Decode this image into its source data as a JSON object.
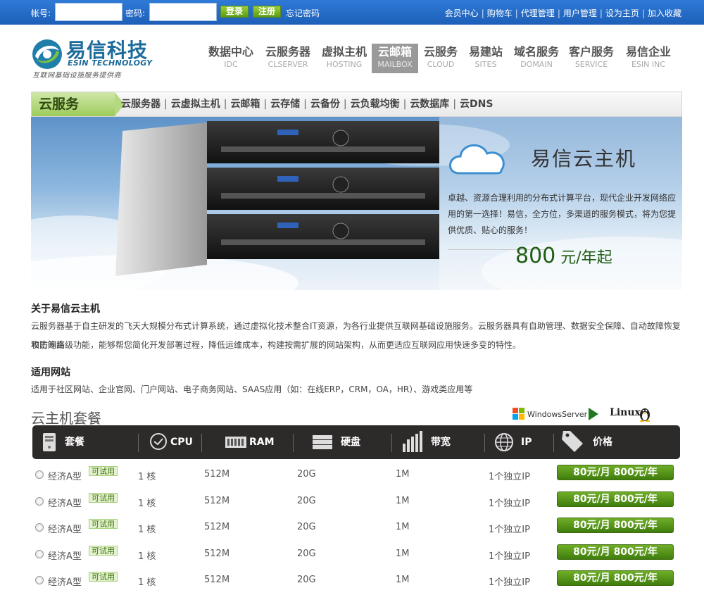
{
  "topbar": {
    "account_label": "帐号:",
    "account_value": "",
    "password_label": "密码:",
    "password_value": "",
    "login_label": "登录",
    "register_label": "注册",
    "forgot_label": "忘记密码",
    "links": [
      "会员中心",
      "购物车",
      "代理管理",
      "用户管理",
      "设为主页",
      "加入收藏"
    ]
  },
  "logo": {
    "cn": "易信科技",
    "en": "ESIN TECHNOLOGY",
    "tagline": "互联网基础设施服务提供商"
  },
  "nav": [
    {
      "cn": "数据中心",
      "en": "IDC"
    },
    {
      "cn": "云服务器",
      "en": "CLSERVER"
    },
    {
      "cn": "虚拟主机",
      "en": "HOSTING"
    },
    {
      "cn": "云邮箱",
      "en": "MAILBOX",
      "active": true
    },
    {
      "cn": "云服务",
      "en": "CLOUD"
    },
    {
      "cn": "易建站",
      "en": "SITES"
    },
    {
      "cn": "域名服务",
      "en": "DOMAIN"
    },
    {
      "cn": "客户服务",
      "en": "SERVICE"
    },
    {
      "cn": "易信企业",
      "en": "ESIN INC"
    }
  ],
  "subnav": {
    "title": "云服务",
    "links": [
      "云服务器",
      "云虚拟主机",
      "云邮箱",
      "云存储",
      "云备份",
      "云负载均衡",
      "云数据库",
      "云DNS"
    ]
  },
  "banner": {
    "title": "易信云主机",
    "description": "卓越、资源合理利用的分布式计算平台，现代企业开发网络应用的第一选择！易信，全方位，多渠道的服务模式，将为您提供优质、贴心的服务！",
    "price_num": "800",
    "price_unit": " 元/年起"
  },
  "about": {
    "title": "关于易信云主机",
    "line1": "云服务器基于自主研发的飞天大规模分布式计算系统，通过虚拟化技术整合IT资源，为各行业提供互联网基础设施服务。云服务器具有自助管理、数据安全保障、自动故障恢复和防网络",
    "line2": "攻击等高级功能，能够帮您简化开发部署过程，降低运维成本，构建按需扩展的网站架构，从而更适应互联网应用快速多变的特性。"
  },
  "suitable": {
    "title": "适用网站",
    "text": "适用于社区网站、企业官网、门户网站、电子商务网站、SAAS应用（如：在线ERP，CRM，OA，HR）、游戏类应用等"
  },
  "packages": {
    "title": "云主机套餐",
    "os_windows": "WindowsServer",
    "os_linux": "Linux",
    "columns": [
      "套餐",
      "CPU",
      "RAM",
      "硬盘",
      "带宽",
      "IP",
      "价格"
    ],
    "rows": [
      {
        "name": "经济A型",
        "trial": "可试用",
        "cpu": "1 核",
        "ram": "512M",
        "disk": "20G",
        "bw": "1M",
        "ip": "1个独立IP",
        "price": "80元/月 800元/年"
      },
      {
        "name": "经济A型",
        "trial": "可试用",
        "cpu": "1 核",
        "ram": "512M",
        "disk": "20G",
        "bw": "1M",
        "ip": "1个独立IP",
        "price": "80元/月 800元/年"
      },
      {
        "name": "经济A型",
        "trial": "可试用",
        "cpu": "1 核",
        "ram": "512M",
        "disk": "20G",
        "bw": "1M",
        "ip": "1个独立IP",
        "price": "80元/月 800元/年"
      },
      {
        "name": "经济A型",
        "trial": "可试用",
        "cpu": "1 核",
        "ram": "512M",
        "disk": "20G",
        "bw": "1M",
        "ip": "1个独立IP",
        "price": "80元/月 800元/年"
      },
      {
        "name": "经济A型",
        "trial": "可试用",
        "cpu": "1 核",
        "ram": "512M",
        "disk": "20G",
        "bw": "1M",
        "ip": "1个独立IP",
        "price": "80元/月 800元/年"
      }
    ]
  },
  "colors": {
    "topbar": "#1d5fb8",
    "accent_green": "#3f7d0d",
    "price_green": "#1f5d12",
    "table_header": "#2d2a2a"
  }
}
